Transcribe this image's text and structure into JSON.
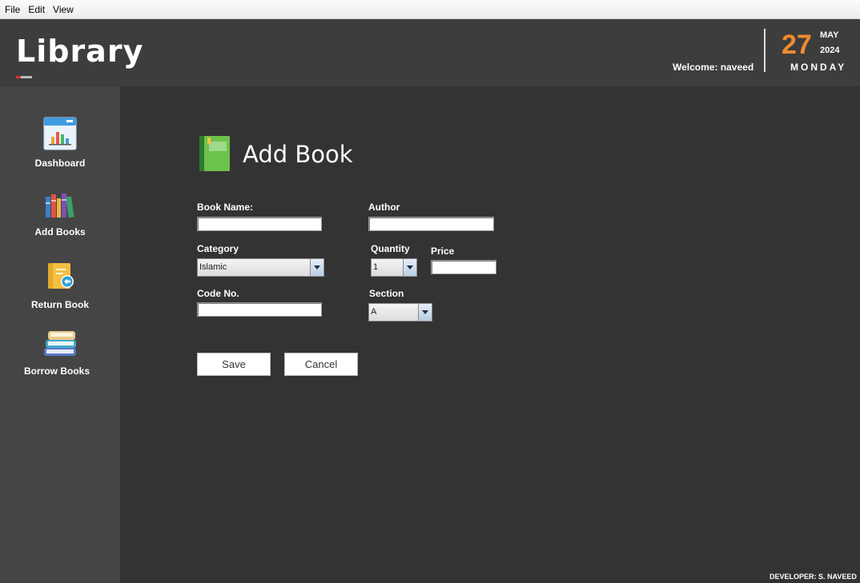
{
  "menu": {
    "items": [
      "File",
      "Edit",
      "View"
    ]
  },
  "header": {
    "logo": "Library",
    "welcome": "Welcome: naveed",
    "date": {
      "day": "27",
      "month": "MAY",
      "year": "2024",
      "weekday": "MONDAY"
    }
  },
  "sidebar": {
    "items": [
      {
        "label": "Dashboard",
        "icon": "dashboard-chart-icon"
      },
      {
        "label": "Add Books",
        "icon": "books-icon"
      },
      {
        "label": "Return Book",
        "icon": "return-book-icon"
      },
      {
        "label": "Borrow Books",
        "icon": "book-stack-icon"
      }
    ]
  },
  "form": {
    "title": "Add Book",
    "book_name": {
      "label": "Book Name:",
      "value": ""
    },
    "author": {
      "label": "Author",
      "value": ""
    },
    "category": {
      "label": "Category",
      "selected": "Islamic"
    },
    "quantity": {
      "label": "Quantity",
      "selected": "1"
    },
    "price": {
      "label": "Price",
      "value": ""
    },
    "code_no": {
      "label": "Code No.",
      "value": ""
    },
    "section": {
      "label": "Section",
      "selected": "A"
    },
    "save_label": "Save",
    "cancel_label": "Cancel"
  },
  "footer": {
    "developer": "DEVELOPER: S. NAVEED"
  },
  "colors": {
    "accent": "#f08c2e",
    "background": "#333333",
    "sidebar": "#454545",
    "header": "#3d3d3d"
  }
}
